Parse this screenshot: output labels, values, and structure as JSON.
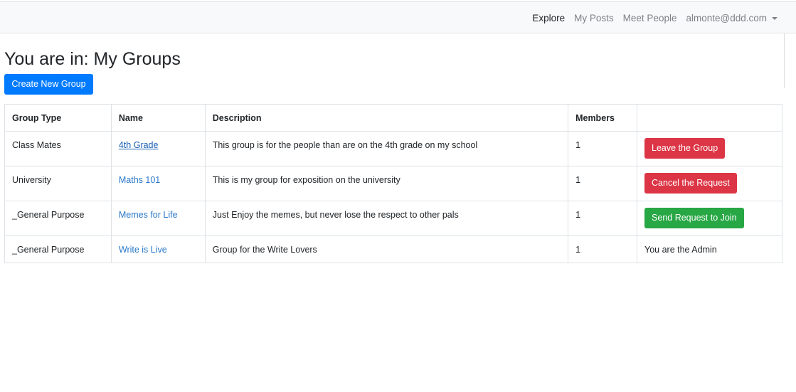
{
  "navbar": {
    "explore": "Explore",
    "my_posts": "My Posts",
    "meet_people": "Meet People",
    "user_email": "almonte@ddd.com"
  },
  "page": {
    "title": "You are in: My Groups",
    "create_button": "Create New Group"
  },
  "table": {
    "headers": {
      "group_type": "Group Type",
      "name": "Name",
      "description": "Description",
      "members": "Members",
      "action": ""
    },
    "rows": [
      {
        "group_type": "Class Mates",
        "name": "4th Grade",
        "description": "This group is for the people than are on the 4th grade on my school",
        "members": "1",
        "action": "Leave the Group"
      },
      {
        "group_type": "University",
        "name": "Maths 101",
        "description": "This is my group for exposition on the university",
        "members": "1",
        "action": "Cancel the Request"
      },
      {
        "group_type": "_General Purpose",
        "name": "Memes for Life",
        "description": "Just Enjoy the memes, but never lose the respect to other pals",
        "members": "1",
        "action": "Send Request to Join"
      },
      {
        "group_type": "_General Purpose",
        "name": "Write is Live",
        "description": "Group for the Write Lovers",
        "members": "1",
        "action": "You are the Admin"
      }
    ]
  },
  "colors": {
    "primary": "#007bff",
    "danger": "#dc3545",
    "success": "#28a745",
    "link": "#2a78c8"
  }
}
